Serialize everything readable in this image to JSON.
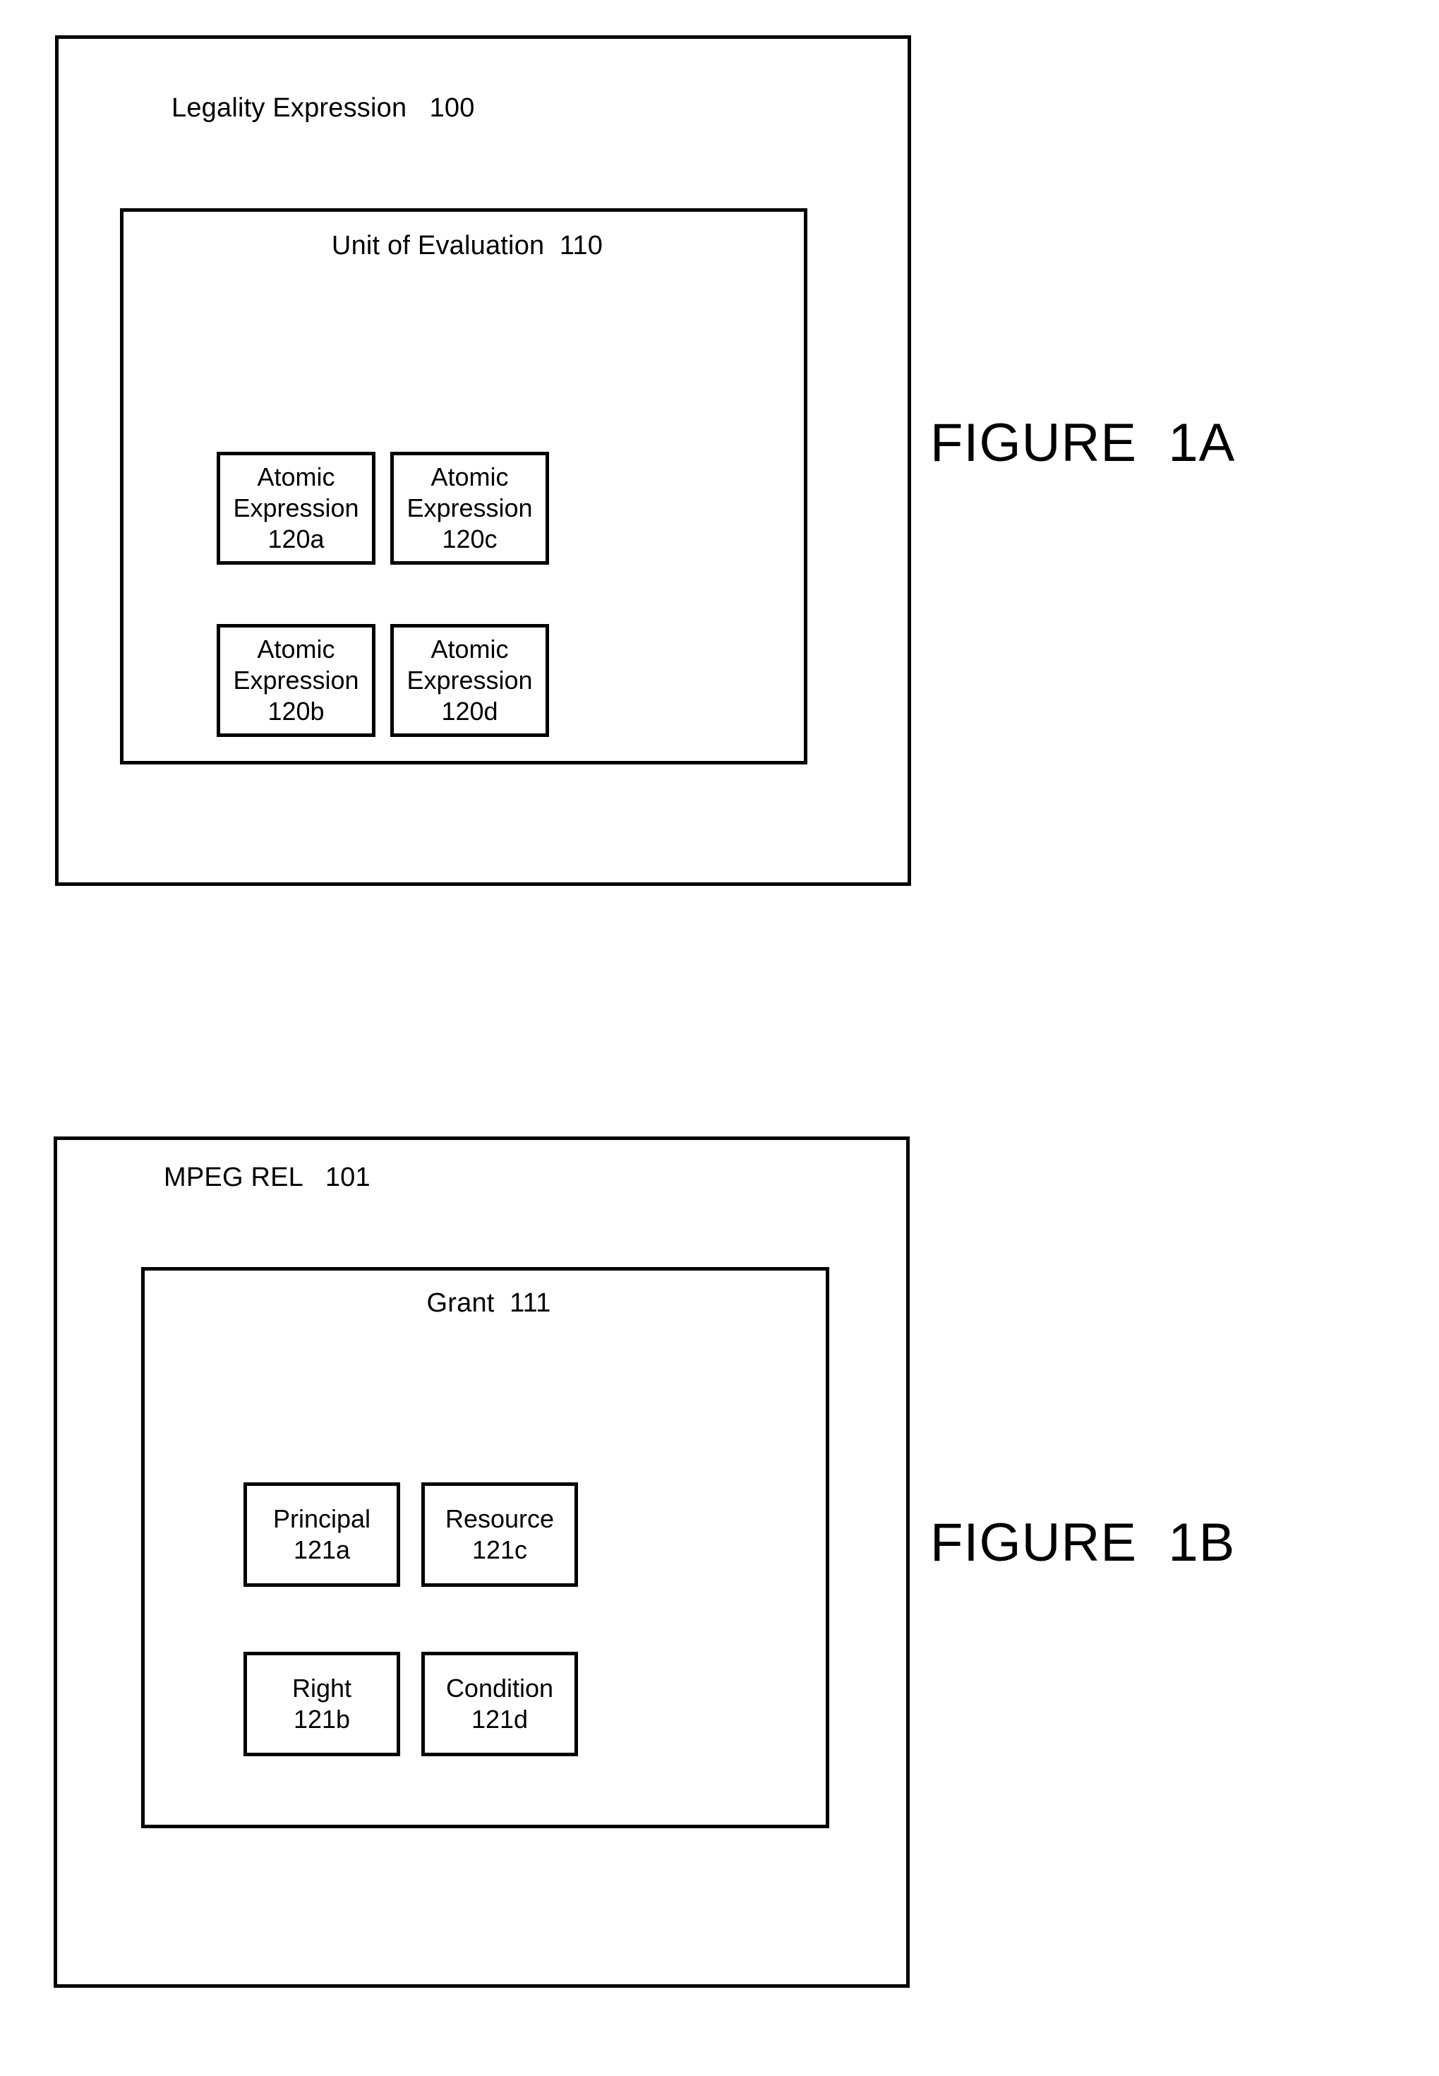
{
  "figures": [
    {
      "id": "1A",
      "caption": "FIGURE  1A",
      "outer": {
        "title": "Legality Expression   100",
        "label": "Legality Expression",
        "ref": "100"
      },
      "inner": {
        "title": "Unit of Evaluation  110",
        "label": "Unit of Evaluation",
        "ref": "110"
      },
      "cells": [
        {
          "line1": "Atomic",
          "line2": "Expression",
          "line3": "120a",
          "ref": "120a"
        },
        {
          "line1": "Atomic",
          "line2": "Expression",
          "line3": "120c",
          "ref": "120c"
        },
        {
          "line1": "Atomic",
          "line2": "Expression",
          "line3": "120b",
          "ref": "120b"
        },
        {
          "line1": "Atomic",
          "line2": "Expression",
          "line3": "120d",
          "ref": "120d"
        }
      ]
    },
    {
      "id": "1B",
      "caption": "FIGURE  1B",
      "outer": {
        "title": "MPEG REL   101",
        "label": "MPEG REL",
        "ref": "101"
      },
      "inner": {
        "title": "Grant  111",
        "label": "Grant",
        "ref": "111"
      },
      "cells": [
        {
          "line1": "Principal",
          "line2": "121a",
          "ref": "121a"
        },
        {
          "line1": "Resource",
          "line2": "121c",
          "ref": "121c"
        },
        {
          "line1": "Right",
          "line2": "121b",
          "ref": "121b"
        },
        {
          "line1": "Condition",
          "line2": "121d",
          "ref": "121d"
        }
      ]
    }
  ],
  "colors": {
    "stroke": "#000000",
    "background": "#ffffff",
    "text": "#000000"
  }
}
